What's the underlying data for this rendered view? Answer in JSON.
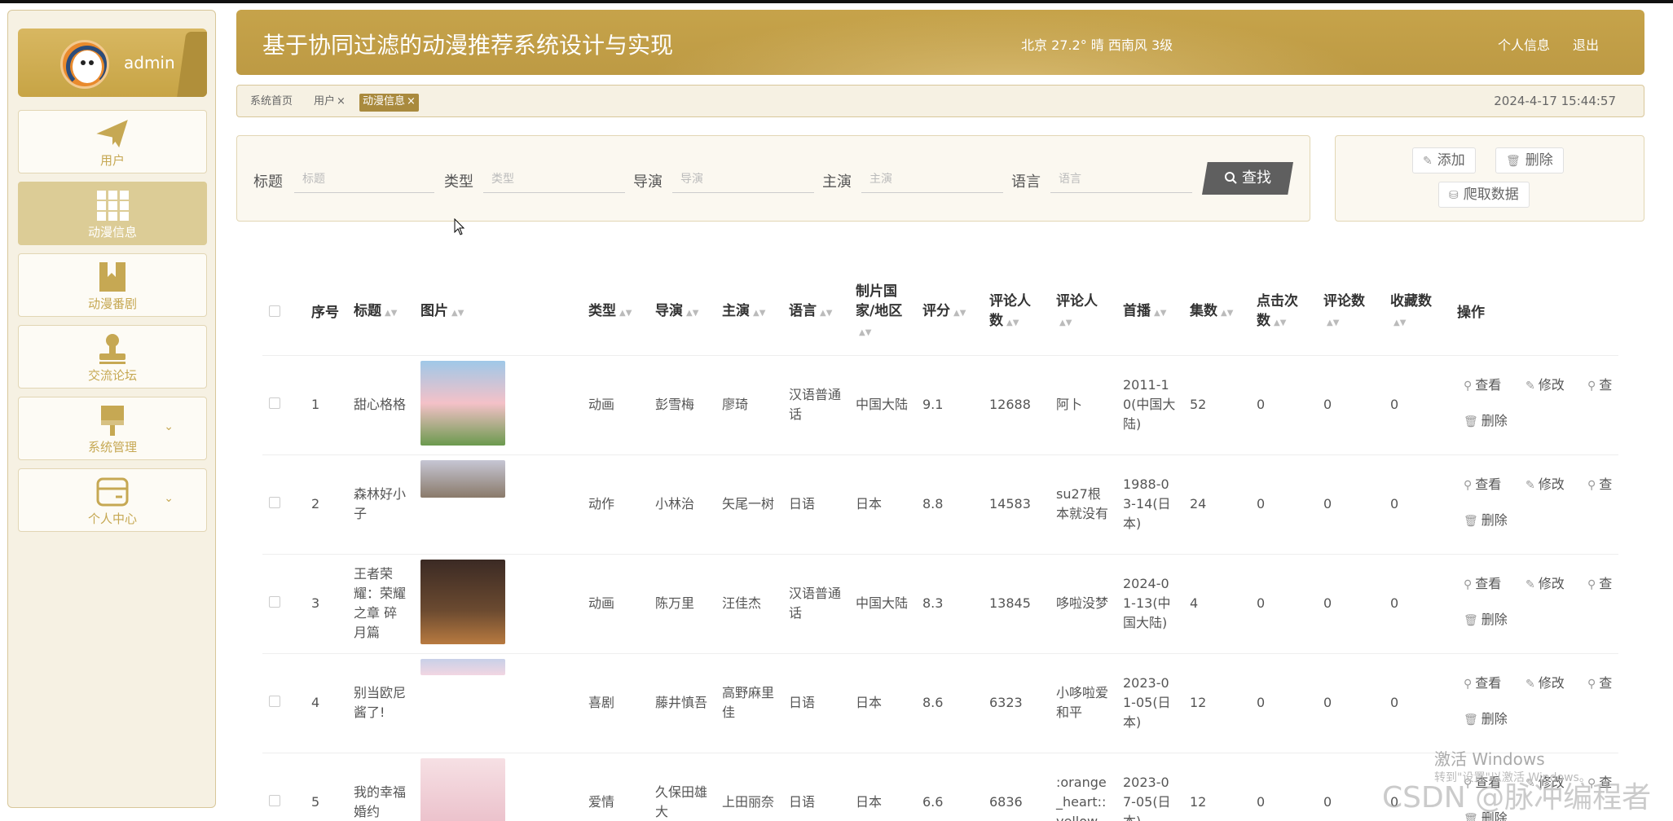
{
  "sidebar": {
    "admin_name": "admin",
    "items": [
      {
        "label": "用户",
        "icon": "paper-plane-icon"
      },
      {
        "label": "动漫信息",
        "icon": "grid-icon"
      },
      {
        "label": "动漫番剧",
        "icon": "bookmark-icon"
      },
      {
        "label": "交流论坛",
        "icon": "stamp-icon"
      },
      {
        "label": "系统管理",
        "icon": "brush-icon"
      },
      {
        "label": "个人中心",
        "icon": "card-icon"
      }
    ]
  },
  "header": {
    "title": "基于协同过滤的动漫推荐系统设计与实现",
    "weather": "北京  27.2°  晴  西南风  3级",
    "profile_link": "个人信息",
    "logout_link": "退出"
  },
  "breadcrumb": {
    "home": "系统首页",
    "tab1": "用户",
    "tab2": "动漫信息",
    "close": "×",
    "datetime": "2024-4-17 15:44:57"
  },
  "search": {
    "title_label": "标题",
    "title_placeholder": "标题",
    "type_label": "类型",
    "type_placeholder": "类型",
    "director_label": "导演",
    "director_placeholder": "导演",
    "actor_label": "主演",
    "actor_placeholder": "主演",
    "language_label": "语言",
    "language_placeholder": "语言",
    "search_button": "查找"
  },
  "actions": {
    "add": "添加",
    "delete": "删除",
    "crawl": "爬取数据"
  },
  "table": {
    "headers": {
      "index": "序号",
      "title": "标题",
      "image": "图片",
      "type": "类型",
      "director": "导演",
      "actor": "主演",
      "language": "语言",
      "country": "制片国家/地区",
      "score": "评分",
      "raters": "评论人数",
      "commenter": "评论人",
      "premiere": "首播",
      "episodes": "集数",
      "clicks": "点击次数",
      "comments": "评论数",
      "favorites": "收藏数",
      "ops": "操作"
    },
    "op_labels": {
      "view": "查看",
      "edit": "修改",
      "view2": "查",
      "delete": "删除"
    },
    "rows": [
      {
        "index": "1",
        "title": "甜心格格",
        "type": "动画",
        "director": "彭雪梅",
        "actor": "廖琦",
        "language": "汉语普通话",
        "country": "中国大陆",
        "score": "9.1",
        "raters": "12688",
        "commenter": "阿卜",
        "premiere": "2011-10(中国大陆)",
        "episodes": "52",
        "clicks": "0",
        "comments": "0",
        "favorites": "0"
      },
      {
        "index": "2",
        "title": "森林好小子",
        "type": "动作",
        "director": "小林治",
        "actor": "矢尾一树",
        "language": "日语",
        "country": "日本",
        "score": "8.8",
        "raters": "14583",
        "commenter": "su27根本就没有",
        "premiere": "1988-03-14(日本)",
        "episodes": "24",
        "clicks": "0",
        "comments": "0",
        "favorites": "0"
      },
      {
        "index": "3",
        "title": "王者荣耀：荣耀之章 碎月篇",
        "type": "动画",
        "director": "陈万里",
        "actor": "汪佳杰",
        "language": "汉语普通话",
        "country": "中国大陆",
        "score": "8.3",
        "raters": "13845",
        "commenter": "哆啦没梦",
        "premiere": "2024-01-13(中国大陆)",
        "episodes": "4",
        "clicks": "0",
        "comments": "0",
        "favorites": "0"
      },
      {
        "index": "4",
        "title": "别当欧尼酱了!",
        "type": "喜剧",
        "director": "藤井慎吾",
        "actor": "高野麻里佳",
        "language": "日语",
        "country": "日本",
        "score": "8.6",
        "raters": "6323",
        "commenter": "小哆啦爱和平",
        "premiere": "2023-01-05(日本)",
        "episodes": "12",
        "clicks": "0",
        "comments": "0",
        "favorites": "0"
      },
      {
        "index": "5",
        "title": "我的幸福婚约",
        "type": "爱情",
        "director": "久保田雄大",
        "actor": "上田丽奈",
        "language": "日语",
        "country": "日本",
        "score": "6.6",
        "raters": "6836",
        "commenter": ":orange_heart::yellow_",
        "premiere": "2023-07-05(日本)",
        "episodes": "12",
        "clicks": "0",
        "comments": "0",
        "favorites": "0"
      }
    ]
  },
  "watermark": {
    "activate": "激活 Windows",
    "activate_sub": "转到\"设置\"以激活 Windows。",
    "csdn": "CSDN @脉冲编程者"
  },
  "colors": {
    "accent": "#c6a34a",
    "active_nav": "#dccc96",
    "tab_active": "#a98a3e"
  }
}
